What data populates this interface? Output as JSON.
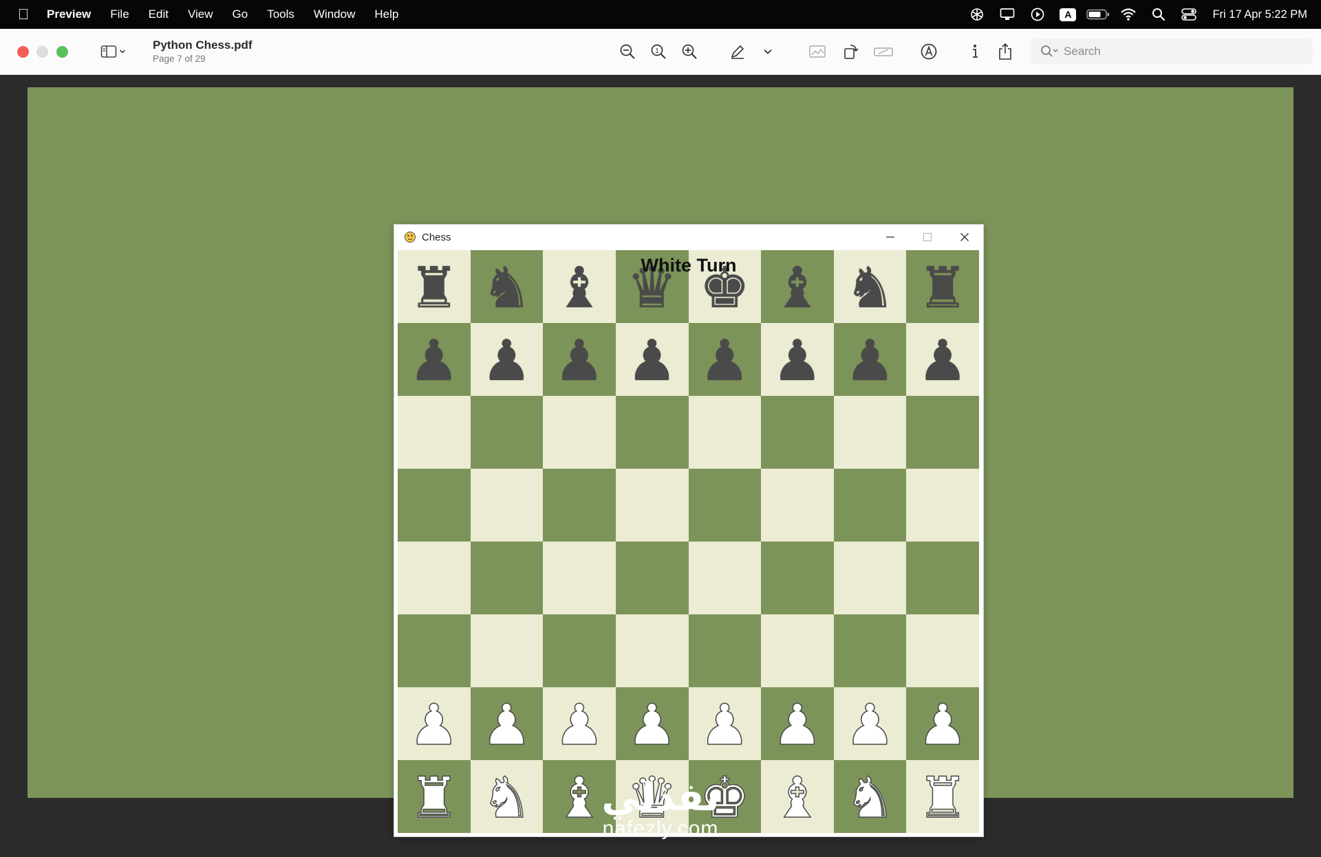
{
  "menubar": {
    "app_name": "Preview",
    "items": [
      "File",
      "Edit",
      "View",
      "Go",
      "Tools",
      "Window",
      "Help"
    ],
    "input_indicator": "A",
    "clock": "Fri 17 Apr  5:22 PM"
  },
  "toolbar": {
    "document_name": "Python Chess.pdf",
    "page_info": "Page 7 of 29",
    "search_placeholder": "Search",
    "icons": [
      "sidebar-icon",
      "zoom-out-icon",
      "actual-size-icon",
      "zoom-in-icon",
      "highlight-pen-icon",
      "chevron-down-icon",
      "markup-shapes-icon",
      "rotate-icon",
      "crop-icon",
      "annotate-icon",
      "info-icon",
      "share-icon",
      "search-icon"
    ]
  },
  "chess_window": {
    "title": "Chess",
    "turn_label": "White Turn",
    "board_colors": {
      "light": "#ebecd3",
      "dark": "#7c9459"
    },
    "board": [
      [
        "bR",
        "bN",
        "bB",
        "bQ",
        "bK",
        "bB",
        "bN",
        "bR"
      ],
      [
        "bP",
        "bP",
        "bP",
        "bP",
        "bP",
        "bP",
        "bP",
        "bP"
      ],
      [
        "",
        "",
        "",
        "",
        "",
        "",
        "",
        ""
      ],
      [
        "",
        "",
        "",
        "",
        "",
        "",
        "",
        ""
      ],
      [
        "",
        "",
        "",
        "",
        "",
        "",
        "",
        ""
      ],
      [
        "",
        "",
        "",
        "",
        "",
        "",
        "",
        ""
      ],
      [
        "wP",
        "wP",
        "wP",
        "wP",
        "wP",
        "wP",
        "wP",
        "wP"
      ],
      [
        "wR",
        "wN",
        "wB",
        "wQ",
        "wK",
        "wB",
        "wN",
        "wR"
      ]
    ]
  },
  "watermark": {
    "arabic": "نفذلي",
    "latin": "nafezly.com"
  },
  "colors": {
    "page_background": "#7c9459",
    "desktop_background": "#2b2b2b",
    "menubar": "#060606"
  }
}
